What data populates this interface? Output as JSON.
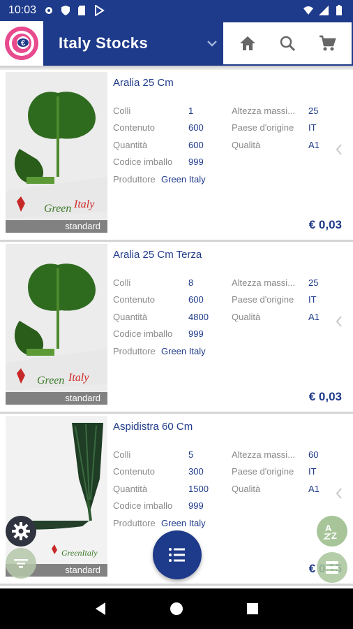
{
  "status_bar": {
    "time": "10:03"
  },
  "app_bar": {
    "title": "Italy Stocks"
  },
  "products": [
    {
      "title": "Aralia 25 Cm",
      "badge": "standard",
      "labels": {
        "colli": "Colli",
        "contenuto": "Contenuto",
        "quantita": "Quantità",
        "codice": "Codice imballo",
        "produttore": "Produttore",
        "altezza": "Altezza massi...",
        "paese": "Paese d'origine",
        "qualita": "Qualità"
      },
      "values": {
        "colli": "1",
        "contenuto": "600",
        "quantita": "600",
        "codice": "999",
        "produttore": "Green Italy",
        "altezza": "25",
        "paese": "IT",
        "qualita": "A1"
      },
      "price": "€ 0,03"
    },
    {
      "title": "Aralia 25 Cm Terza",
      "badge": "standard",
      "labels": {
        "colli": "Colli",
        "contenuto": "Contenuto",
        "quantita": "Quantità",
        "codice": "Codice imballo",
        "produttore": "Produttore",
        "altezza": "Altezza massi...",
        "paese": "Paese d'origine",
        "qualita": "Qualità"
      },
      "values": {
        "colli": "8",
        "contenuto": "600",
        "quantita": "4800",
        "codice": "999",
        "produttore": "Green Italy",
        "altezza": "25",
        "paese": "IT",
        "qualita": "A1"
      },
      "price": "€ 0,03"
    },
    {
      "title": "Aspidistra 60 Cm",
      "badge": "standard",
      "labels": {
        "colli": "Colli",
        "contenuto": "Contenuto",
        "quantita": "Quantità",
        "codice": "Codice imballo",
        "produttore": "Produttore",
        "altezza": "Altezza massi...",
        "paese": "Paese d'origine",
        "qualita": "Qualità"
      },
      "values": {
        "colli": "5",
        "contenuto": "300",
        "quantita": "1500",
        "codice": "999",
        "produttore": "Green Italy",
        "altezza": "60",
        "paese": "IT",
        "qualita": "A1"
      },
      "price": "€ 0,15"
    }
  ],
  "colors": {
    "primary": "#1e3a8a",
    "label_gray": "#8a8a8a",
    "fab_green": "#a8c59a"
  },
  "icons": [
    "settings-icon",
    "shield-icon",
    "sd-card-icon",
    "play-store-icon",
    "wifi-icon",
    "signal-icon",
    "battery-icon",
    "home-icon",
    "search-icon",
    "cart-icon",
    "dropdown-icon",
    "chevron-left-icon",
    "list-icon",
    "gear-icon",
    "filter-icon",
    "sort-az-icon",
    "back-icon",
    "home-nav-icon",
    "recents-icon"
  ]
}
